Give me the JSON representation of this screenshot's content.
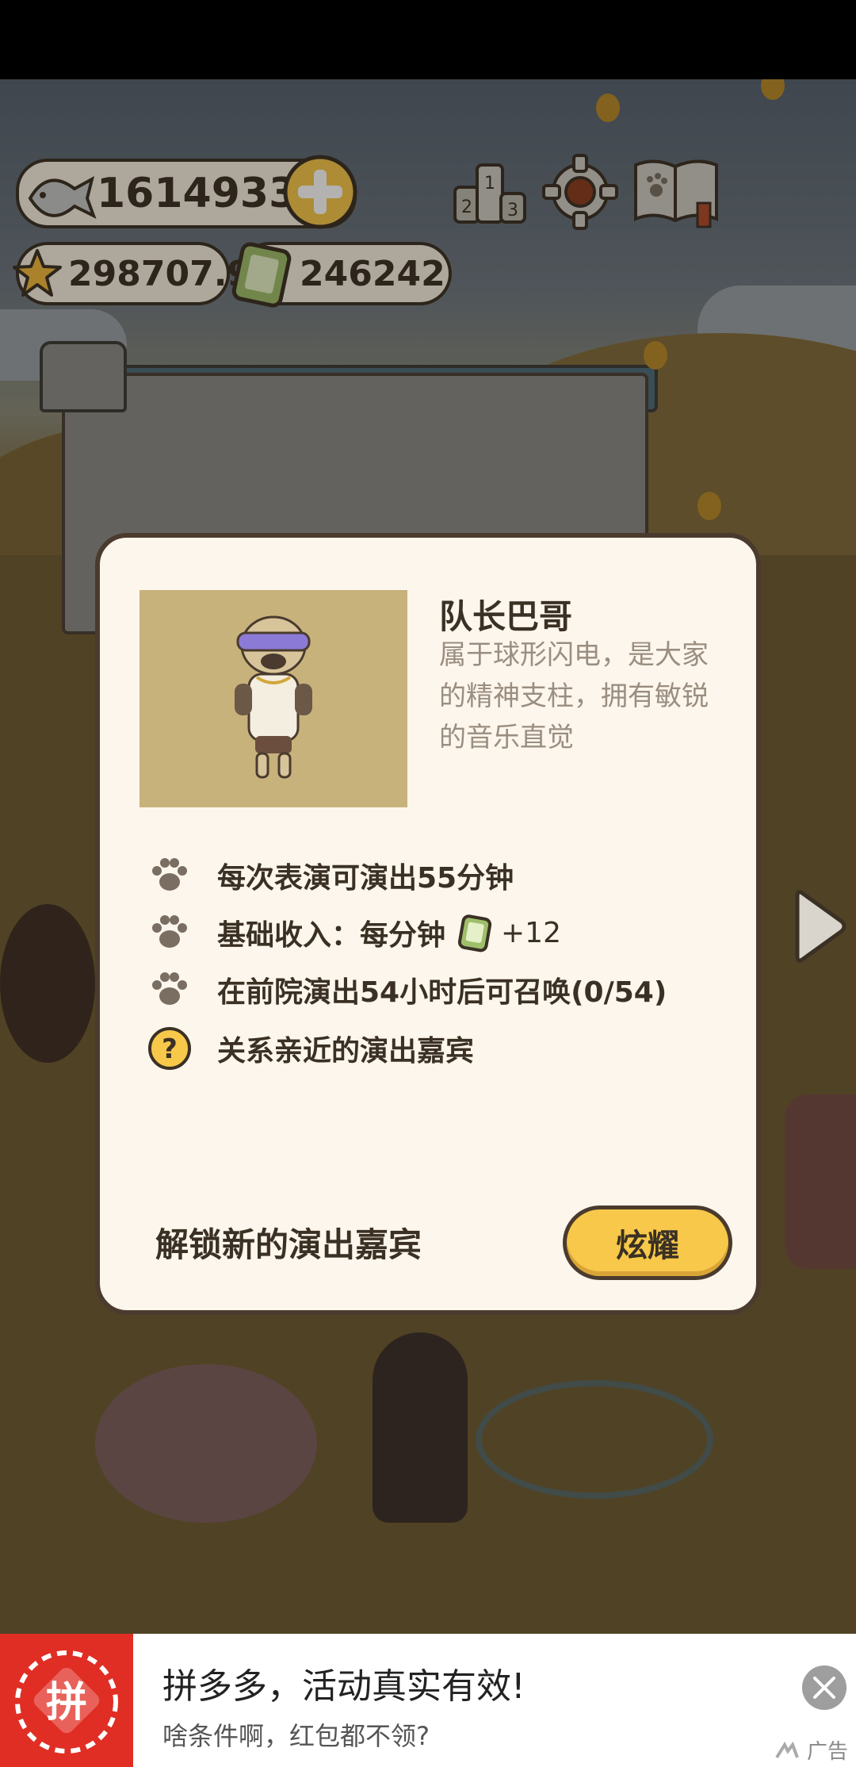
{
  "hud": {
    "fish_count": "16149333",
    "star_count": "298707.9",
    "phone_count": "246242"
  },
  "icons": {
    "fish": "fish-icon",
    "plus": "plus-icon",
    "star": "star-icon",
    "phone": "phone-icon",
    "ranking": "ranking-podium-icon",
    "settings": "gear-icon",
    "album": "paw-book-icon",
    "paw": "paw-icon",
    "question": "question-icon",
    "next": "chevron-right-icon",
    "close": "close-icon"
  },
  "modal": {
    "name": "队长巴哥",
    "description": "属于球形闪电，是大家的精神支柱，拥有敏锐的音乐直觉",
    "rows": [
      {
        "text": "每次表演可演出55分钟"
      },
      {
        "text": "基础收入：每分钟",
        "suffix": "+12"
      },
      {
        "text": "在前院演出54小时后可召唤(0/54)"
      },
      {
        "text": "关系亲近的演出嘉宾"
      }
    ],
    "unlock_label": "解锁新的演出嘉宾",
    "button_label": "炫耀"
  },
  "ad": {
    "title": "拼多多，活动真实有效!",
    "subtitle": "啥条件啊，红包都不领?",
    "label": "广告",
    "logo_text": "拼"
  },
  "colors": {
    "panel": "#fdf6ec",
    "outline": "#4a3b2e",
    "button": "#f7c84a",
    "ad_brand": "#e02e24"
  }
}
